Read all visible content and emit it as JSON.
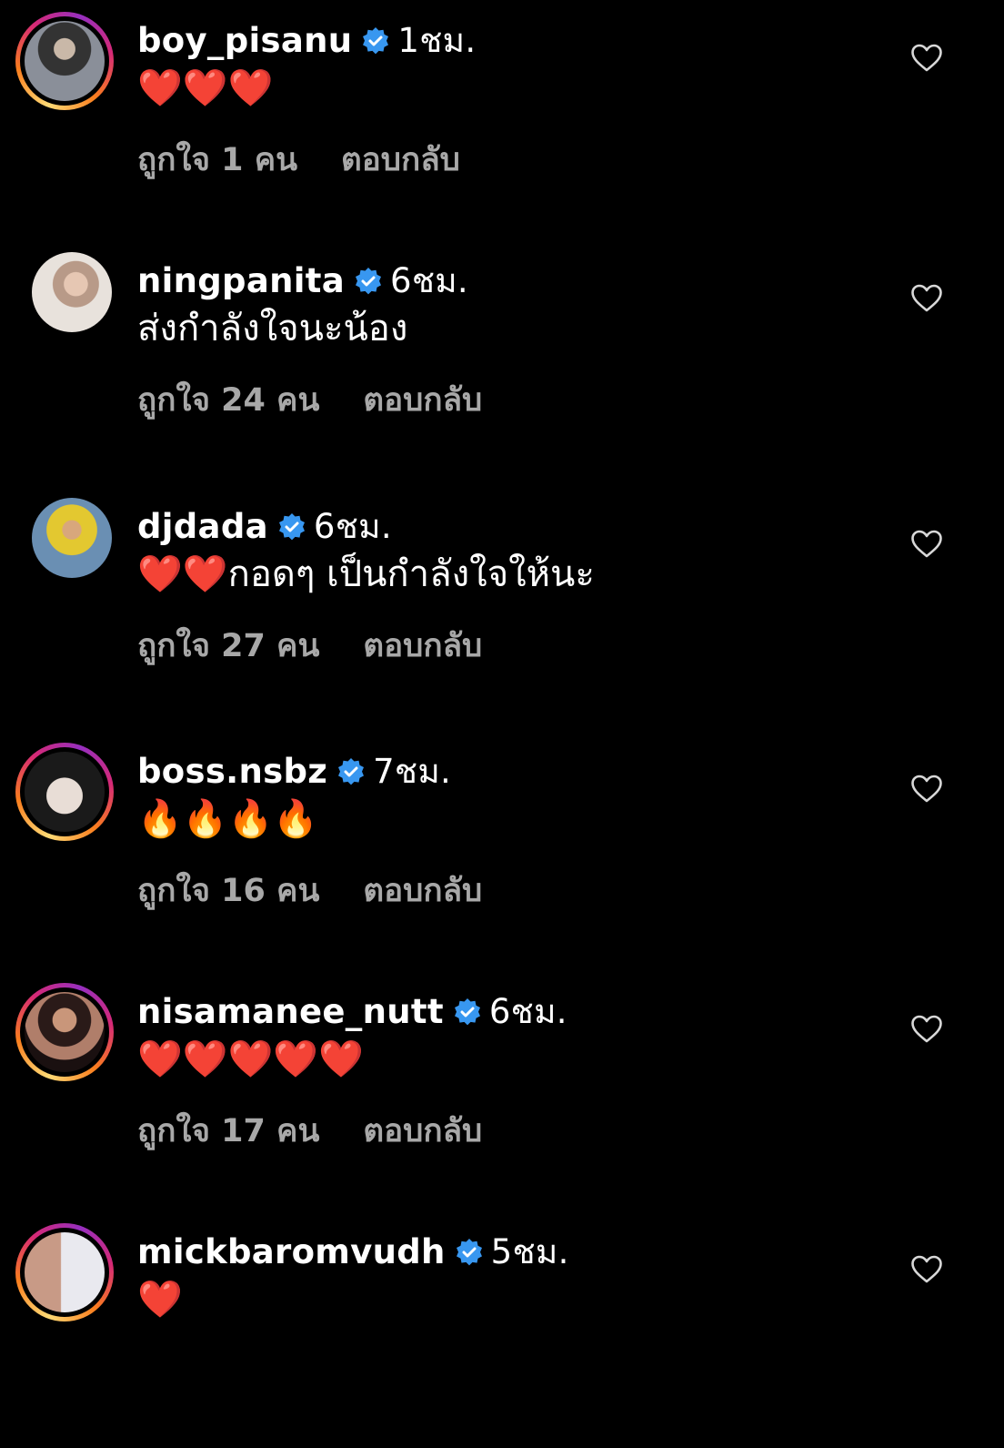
{
  "comments": [
    {
      "username": "boy_pisanu",
      "time": "1ชม.",
      "text": "❤️❤️❤️",
      "likes": "ถูกใจ 1 คน",
      "reply": "ตอบกลับ",
      "story_ring": true,
      "avatar_icon": "profile-photo"
    },
    {
      "username": "ningpanita",
      "time": "6ชม.",
      "text": "ส่งกำลังใจนะน้อง",
      "likes": "ถูกใจ 24 คน",
      "reply": "ตอบกลับ",
      "story_ring": false,
      "avatar_icon": "profile-photo"
    },
    {
      "username": "djdada",
      "time": "6ชม.",
      "text": "❤️❤️กอดๆ เป็นกำลังใจให้นะ",
      "likes": "ถูกใจ 27 คน",
      "reply": "ตอบกลับ",
      "story_ring": false,
      "avatar_icon": "profile-photo"
    },
    {
      "username": "boss.nsbz",
      "time": "7ชม.",
      "text": "🔥🔥🔥🔥",
      "likes": "ถูกใจ 16 คน",
      "reply": "ตอบกลับ",
      "story_ring": true,
      "avatar_icon": "profile-photo"
    },
    {
      "username": "nisamanee_nutt",
      "time": "6ชม.",
      "text": "❤️❤️❤️❤️❤️",
      "likes": "ถูกใจ 17 คน",
      "reply": "ตอบกลับ",
      "story_ring": true,
      "avatar_icon": "profile-photo"
    },
    {
      "username": "mickbaromvudh",
      "time": "5ชม.",
      "text": "❤️",
      "likes": "",
      "reply": "",
      "story_ring": true,
      "avatar_icon": "profile-photo"
    }
  ],
  "colors": {
    "background": "#000000",
    "verified": "#3897f0",
    "meta": "#a8a8a8",
    "heart": "#e0245e"
  },
  "icons": {
    "verified": "verified-badge-icon",
    "like": "heart-outline-icon"
  }
}
